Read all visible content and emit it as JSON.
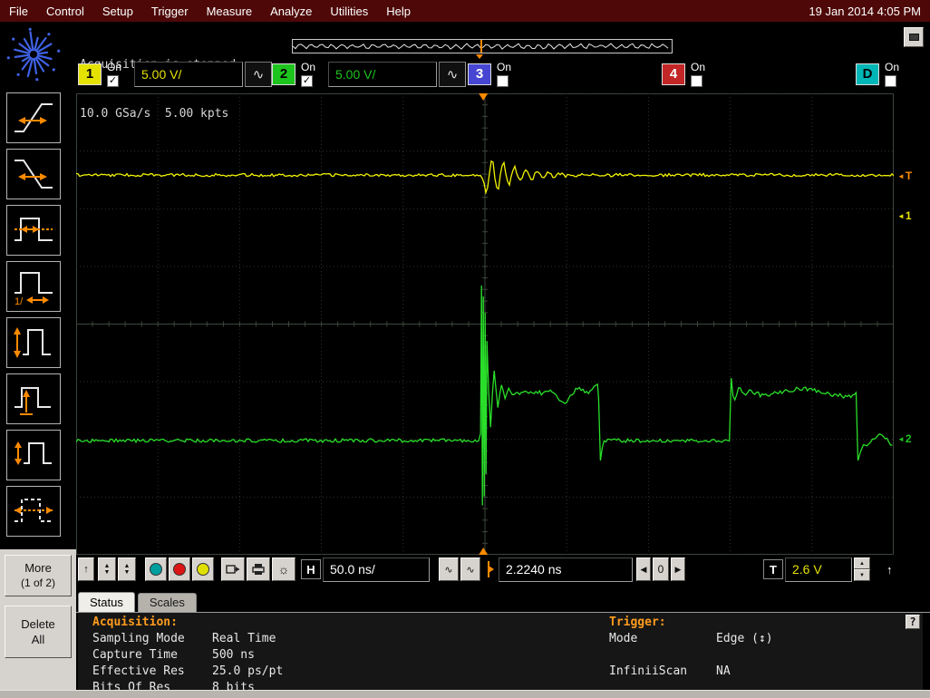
{
  "window": {
    "datetime": "19 Jan 2014 4:05 PM"
  },
  "menubar": {
    "items": [
      "File",
      "Control",
      "Setup",
      "Trigger",
      "Measure",
      "Analyze",
      "Utilities",
      "Help"
    ]
  },
  "acq": {
    "line1": "Acquisition is stopped.",
    "line2": "10.0 GSa/s  5.00 kpts"
  },
  "channels": {
    "ch1": {
      "num": "1",
      "on": "On",
      "scale": "5.00 V/",
      "checked": true
    },
    "ch2": {
      "num": "2",
      "on": "On",
      "scale": "5.00 V/",
      "checked": true
    },
    "ch3": {
      "num": "3",
      "on": "On",
      "checked": false
    },
    "ch4": {
      "num": "4",
      "on": "On",
      "checked": false
    },
    "chd": {
      "num": "D",
      "on": "On",
      "checked": false
    }
  },
  "sidebar": {
    "more": "More",
    "more_sub": "(1 of 2)",
    "delete_line1": "Delete",
    "delete_line2": "All"
  },
  "controls": {
    "h_label": "H",
    "timebase": "50.0 ns/",
    "delay": "2.2240 ns",
    "zero": "0",
    "t_label": "T",
    "trigger_level": "2.6 V"
  },
  "tabs": {
    "status": "Status",
    "scales": "Scales"
  },
  "panel": {
    "acq_header": "Acquisition:",
    "rows": [
      {
        "label": "Sampling Mode",
        "value": "Real Time"
      },
      {
        "label": "Capture Time",
        "value": "500 ns"
      },
      {
        "label": "Effective Res",
        "value": "25.0 ps/pt"
      },
      {
        "label": "Bits Of Res",
        "value": "8 bits"
      }
    ],
    "trig_header": "Trigger:",
    "trig_rows": [
      {
        "label": "Mode",
        "value": "Edge (↕)"
      },
      {
        "label": "InfiniiScan",
        "value": "NA"
      }
    ],
    "help": "?"
  },
  "icons": {
    "up": "↑",
    "left": "◀",
    "right": "▶",
    "small_up": "▲",
    "small_down": "▼",
    "sine": "∿",
    "brightness": "☼",
    "check": "✓",
    "marker_left": "◄"
  },
  "colors": {
    "ch1": "#e6e200",
    "ch2": "#1ec41e",
    "ch3": "#4646d2",
    "ch4": "#c22626",
    "digital": "#00b6b6",
    "trace1": "#f2f200",
    "trace2": "#2adf2a",
    "trigger": "#ff8a00",
    "marker_teal": "#009e9e",
    "marker_red": "#dc1414",
    "marker_yellow": "#e0e000"
  },
  "scope": {
    "marker_t": "T",
    "marker_1": "1",
    "marker_2": "2",
    "ch1_baseline_frac": 0.177,
    "ch2_baseline_frac": 0.7525,
    "ch2_high_frac": 0.6486,
    "trigger_x_frac": 0.498,
    "spike_top_frac": 0.4165,
    "spike_bot_frac": 0.893,
    "step_down_frac": 0.639,
    "step_up_frac": 0.799,
    "step_down2_frac": 0.954
  }
}
